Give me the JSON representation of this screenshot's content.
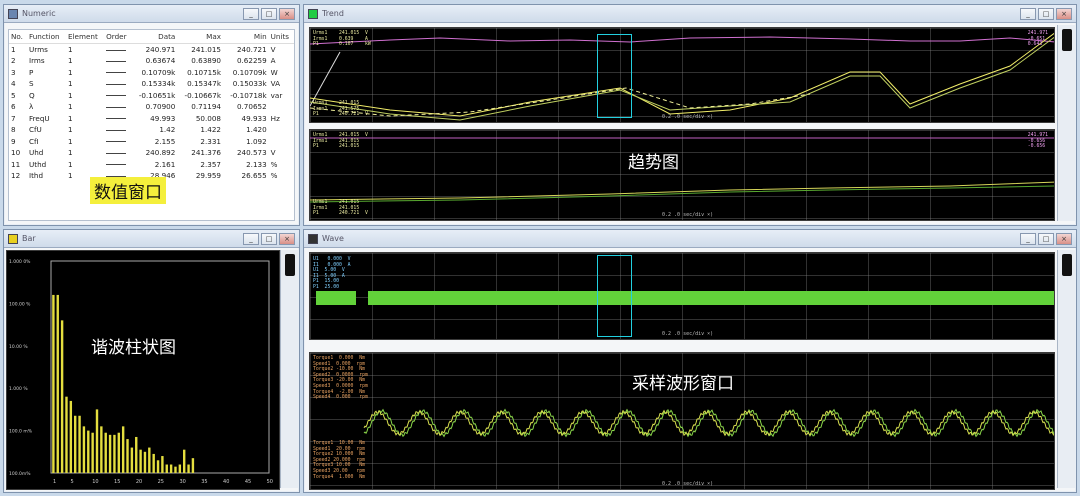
{
  "numeric": {
    "title": "Numeric",
    "headers": [
      "No.",
      "Function",
      "Element",
      "Order",
      "Data",
      "Max",
      "Min",
      "Units"
    ],
    "rows": [
      {
        "no": "1",
        "func": "Urms",
        "el": "1",
        "data": "240.971",
        "max": "241.015",
        "min": "240.721",
        "unit": "V"
      },
      {
        "no": "2",
        "func": "Irms",
        "el": "1",
        "data": "0.63674",
        "max": "0.63890",
        "min": "0.62259",
        "unit": "A"
      },
      {
        "no": "3",
        "func": "P",
        "el": "1",
        "data": "0.10709k",
        "max": "0.10715k",
        "min": "0.10709k",
        "unit": "W"
      },
      {
        "no": "4",
        "func": "S",
        "el": "1",
        "data": "0.15334k",
        "max": "0.15347k",
        "min": "0.15033k",
        "unit": "VA"
      },
      {
        "no": "5",
        "func": "Q",
        "el": "1",
        "data": "-0.10651k",
        "max": "-0.10667k",
        "min": "-0.10718k",
        "unit": "var"
      },
      {
        "no": "6",
        "func": "λ",
        "el": "1",
        "data": "0.70900",
        "max": "0.71194",
        "min": "0.70652",
        "unit": ""
      },
      {
        "no": "7",
        "func": "FreqU",
        "el": "1",
        "data": "49.993",
        "max": "50.008",
        "min": "49.933",
        "unit": "Hz"
      },
      {
        "no": "8",
        "func": "CfU",
        "el": "1",
        "data": "1.42",
        "max": "1.422",
        "min": "1.420",
        "unit": ""
      },
      {
        "no": "9",
        "func": "CfI",
        "el": "1",
        "data": "2.155",
        "max": "2.331",
        "min": "1.092",
        "unit": ""
      },
      {
        "no": "10",
        "func": "Uhd",
        "el": "1",
        "data": "240.892",
        "max": "241.376",
        "min": "240.573",
        "unit": "V"
      },
      {
        "no": "11",
        "func": "Uthd",
        "el": "1",
        "data": "2.161",
        "max": "2.357",
        "min": "2.133",
        "unit": "%"
      },
      {
        "no": "12",
        "func": "Ithd",
        "el": "1",
        "data": "28.946",
        "max": "29.959",
        "min": "26.655",
        "unit": "%"
      }
    ],
    "label": "数值窗口"
  },
  "trend": {
    "title": "Trend",
    "label": "趋势图",
    "footer1": "0.2 .0 sec/div  ×)",
    "footer2": "0.2 .0 sec/div  ×)",
    "left_labels1": "Urms1    241.015  V\nIrms1    0.639    A\nP1       0.107    kW",
    "right_labels1": "241.971\n-0.651\n0.643",
    "left_labels1b": "Urms1    241.015\nIrms1    241.575\nP1       240.721  V",
    "left_labels2": "Urms1    241.015  V\nIrms1    241.015\nP1       241.015",
    "right_labels2": "241.971\n-0.656\n-0.656",
    "left_labels2b": "Urms1    241.015\nIrms1    241.015\nP1       240.721  V"
  },
  "bar": {
    "title": "Bar",
    "label": "谐波柱状图",
    "yticks": [
      "1.000 0%",
      "100.00 %",
      "10.00 %",
      "1.000 %",
      "100.0 m%",
      "100.0m%"
    ],
    "xticks": [
      "1",
      "5",
      "10",
      "15",
      "20",
      "25",
      "30",
      "35",
      "40",
      "45",
      "50"
    ]
  },
  "wave": {
    "title": "Wave",
    "label": "采样波形窗口",
    "footer1": "0.2 .0 sec/div  ×)",
    "footer2": "0.2 .0 sec/div  ×)",
    "left_labels1": "U1   0.000  V\nI1   0.000  A\nU1  5.00  V\nI1  5.00  A\nP1  15.00\nP1  25.00",
    "left_labels2": "Torque1  0.000  Nm\nSpeed1  0.000  rpm\nTorque2 -10.00  Nm\nSpeed2  0.0000  rpm\nTorque3 -20.00  Nm\nSpeed3  0.0000  rpm\nTorque4  -2.00  Nm\nSpeed4  0.000   rpm",
    "left_labels3": "Torque1  10.00  Nm\nSpeed1  20.00  rpm\nTorque2 10.000  Nm\nSpeed2 20.000  rpm\nTorque3 10.00   Nm\nSpeed3 20.00   rpm\nTorque4  1.000  Nm"
  },
  "chart_data": {
    "type": "bar",
    "categories": [
      "1",
      "2",
      "3",
      "4",
      "5",
      "6",
      "7",
      "8",
      "9",
      "10",
      "11",
      "12",
      "13",
      "14",
      "15",
      "16",
      "17",
      "18",
      "19",
      "20",
      "21",
      "22",
      "23",
      "24",
      "25",
      "26",
      "27",
      "28",
      "29",
      "30",
      "31",
      "32",
      "33",
      "34",
      "35",
      "36",
      "37",
      "38",
      "39",
      "40",
      "41",
      "42",
      "43",
      "44",
      "45",
      "46",
      "47",
      "48",
      "49",
      "50"
    ],
    "values": [
      0.84,
      0.84,
      0.72,
      0.36,
      0.34,
      0.27,
      0.27,
      0.22,
      0.2,
      0.19,
      0.3,
      0.22,
      0.19,
      0.18,
      0.18,
      0.19,
      0.22,
      0.16,
      0.12,
      0.17,
      0.11,
      0.1,
      0.12,
      0.09,
      0.06,
      0.08,
      0.04,
      0.04,
      0.03,
      0.04,
      0.11,
      0.04,
      0.07
    ],
    "colors": {
      "bars": "#e4de3f",
      "background": "#000000"
    }
  }
}
